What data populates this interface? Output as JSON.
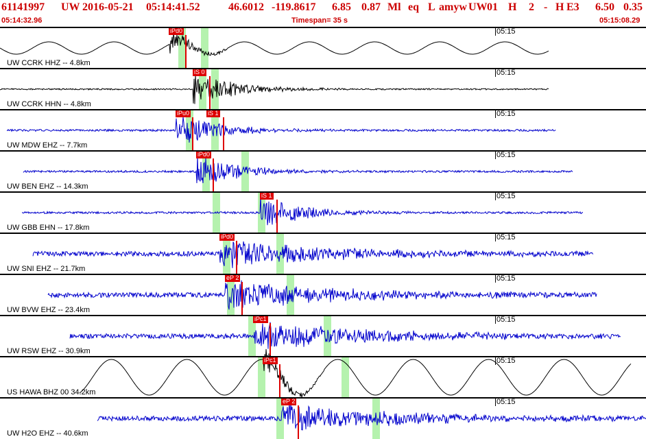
{
  "header": {
    "event_id": "61141997",
    "network": "UW",
    "date": "2016-05-21",
    "time": "05:14:41.52",
    "lat": "46.6012",
    "lon": "-119.8617",
    "depth": "6.85",
    "mag": "0.87",
    "mag_type": "Ml",
    "etype": "eq",
    "flag": "L",
    "author": "amyw",
    "net2": "UW",
    "code1": "01",
    "code2": "H",
    "code3": "2",
    "code4": "-",
    "code5": "H",
    "code6": "E3",
    "val1": "6.50",
    "val2": "0.35",
    "start_time": "05:14:32.96",
    "timespan": "Timespan=  35 s",
    "end_time": "05:15:08.29"
  },
  "channels": [
    {
      "label": "UW CCRK HHZ -- 4.8km",
      "time": "05:15",
      "color": "#000000",
      "kind": "long",
      "picks": [
        "iPd0"
      ]
    },
    {
      "label": "UW CCRK HHN -- 4.8km",
      "time": "05:15",
      "color": "#000000",
      "kind": "noise",
      "picks": [
        "iS 0"
      ]
    },
    {
      "label": "UW MDW EHZ -- 7.7km",
      "time": "05:15",
      "color": "#0000cc",
      "kind": "noise",
      "picks": [
        "iPu0",
        "iS 1"
      ]
    },
    {
      "label": "UW BEN EHZ -- 14.3km",
      "time": "05:15",
      "color": "#0000cc",
      "kind": "noise",
      "picks": [
        "iPd0"
      ]
    },
    {
      "label": "UW GBB EHN -- 17.8km",
      "time": "05:15",
      "color": "#0000cc",
      "kind": "noise",
      "picks": [
        "iS 1"
      ]
    },
    {
      "label": "UW SNI EHZ -- 21.7km",
      "time": "05:15",
      "color": "#0000cc",
      "kind": "noise",
      "picks": [
        "iPd0"
      ]
    },
    {
      "label": "UW BVW EHZ -- 23.4km",
      "time": "05:15",
      "color": "#0000cc",
      "kind": "noise",
      "picks": [
        "eP 2"
      ]
    },
    {
      "label": "UW RSW EHZ -- 30.9km",
      "time": "05:15",
      "color": "#0000cc",
      "kind": "noise",
      "picks": [
        "iPc1"
      ]
    },
    {
      "label": "US HAWA BHZ 00 34.2km",
      "time": "05:15",
      "color": "#000000",
      "kind": "long",
      "picks": [
        "iPc1"
      ]
    },
    {
      "label": "UW H2O EHZ -- 40.6km",
      "time": "05:15",
      "color": "#0000cc",
      "kind": "noise",
      "picks": [
        "eP 2"
      ]
    }
  ]
}
